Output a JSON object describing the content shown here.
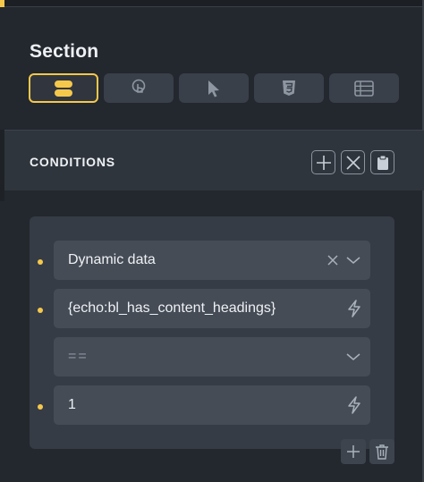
{
  "panel": {
    "title": "Section"
  },
  "tabs": [
    {
      "icon": "toggle-icon",
      "active": true
    },
    {
      "icon": "touch-icon",
      "active": false
    },
    {
      "icon": "cursor-icon",
      "active": false
    },
    {
      "icon": "css3-icon",
      "active": false
    },
    {
      "icon": "list-icon",
      "active": false
    }
  ],
  "conditions": {
    "title": "CONDITIONS",
    "actions": [
      "add-icon",
      "close-icon",
      "clipboard-icon"
    ],
    "group": {
      "source": {
        "value": "Dynamic data"
      },
      "key": {
        "value": "{echo:bl_has_content_headings}"
      },
      "compare": {
        "placeholder": "=="
      },
      "value": {
        "value": "1"
      }
    },
    "footer_actions": [
      "add-icon",
      "trash-icon"
    ]
  },
  "colors": {
    "accent": "#f5c84c",
    "background": "#23272e",
    "field": "#454c56"
  }
}
